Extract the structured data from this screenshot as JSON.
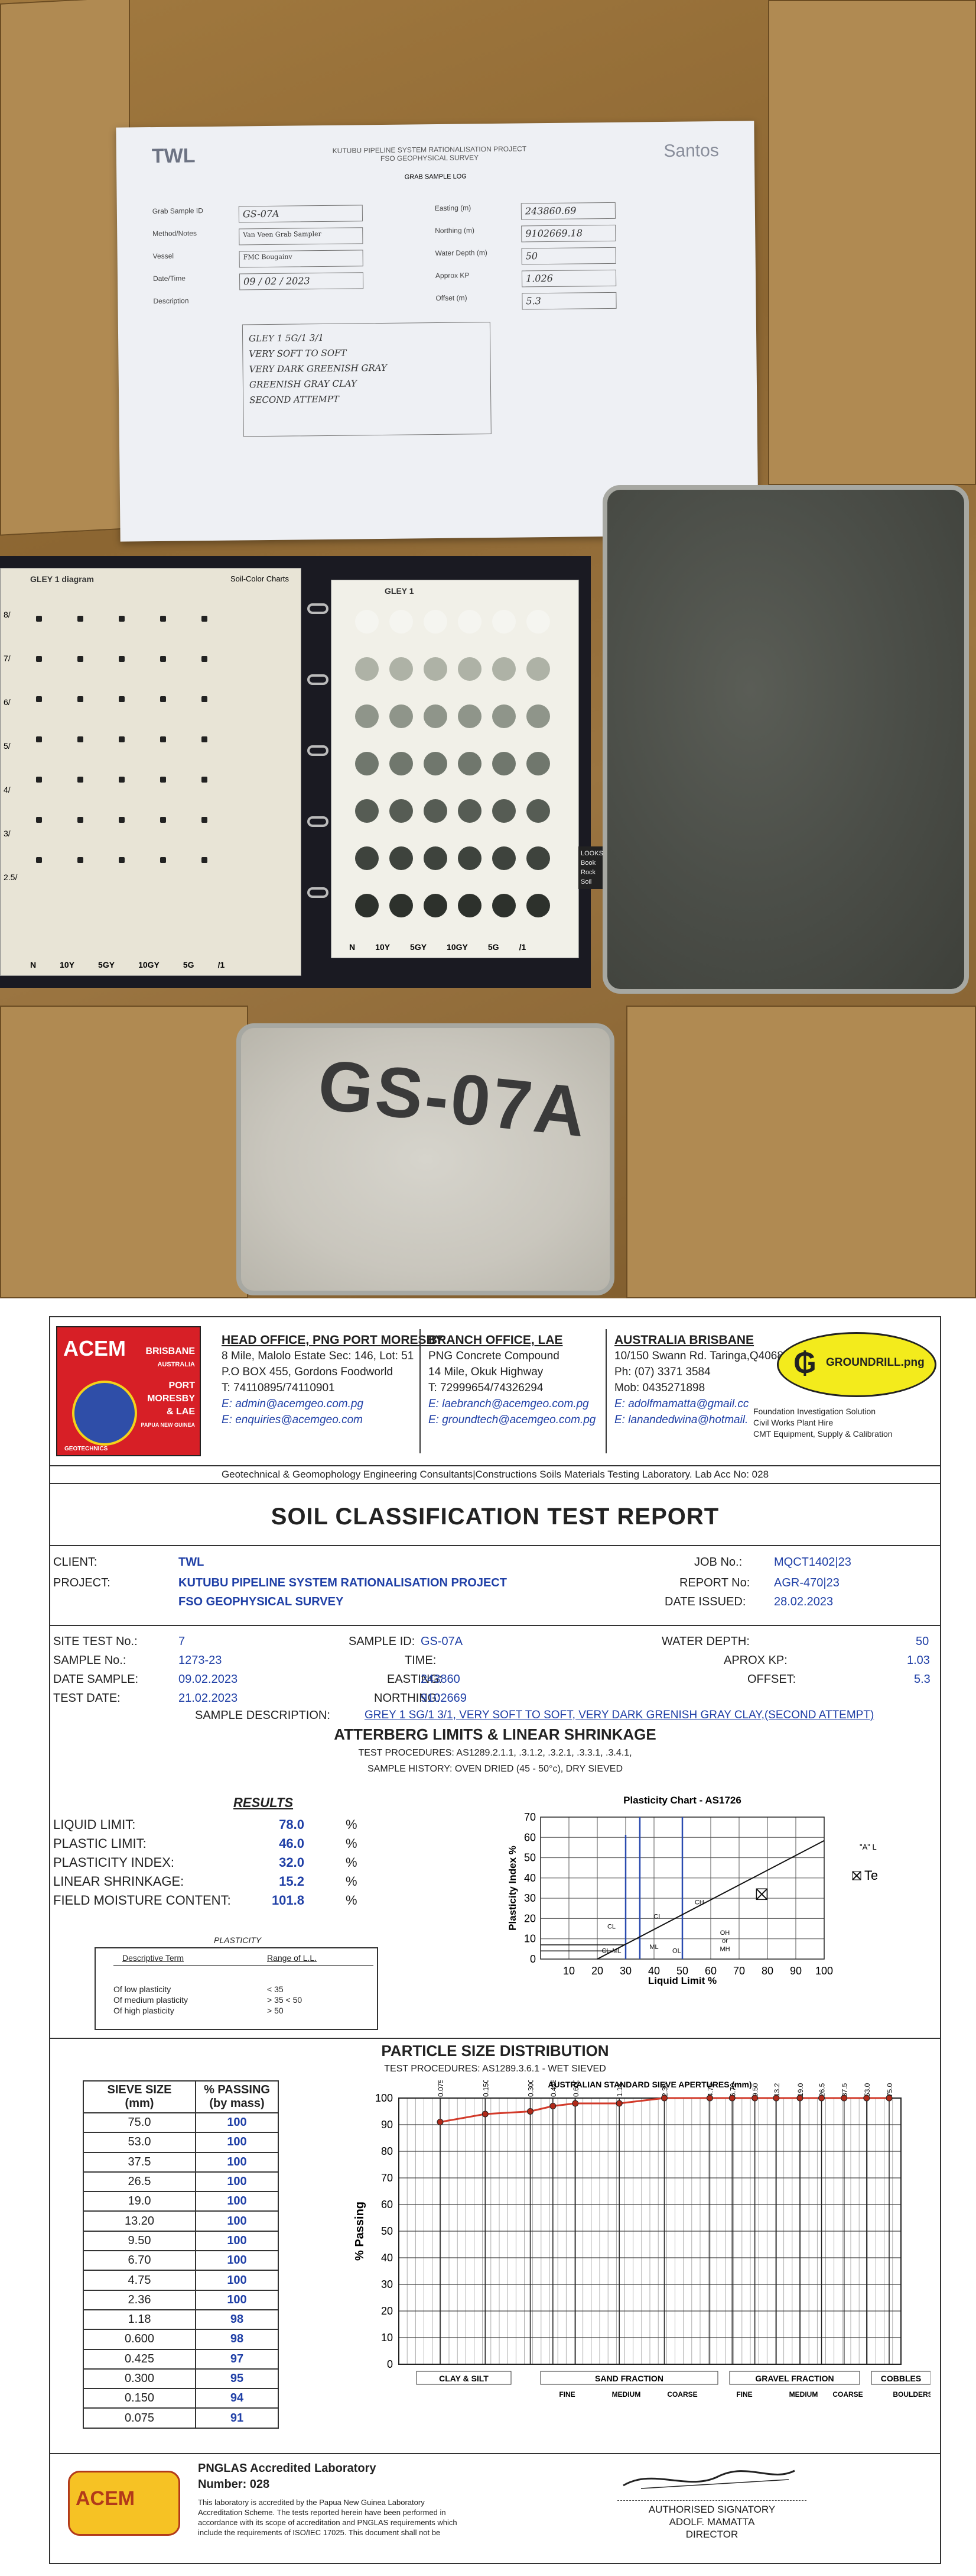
{
  "photo": {
    "sample_sheet": {
      "logo": "TWL",
      "project_line1": "KUTUBU PIPELINE SYSTEM RATIONALISATION PROJECT",
      "project_line2": "FSO GEOPHYSICAL SURVEY",
      "client_logo": "Santos",
      "form_title": "GRAB SAMPLE LOG",
      "labels": [
        "Grab Sample ID",
        "Method/Notes",
        "Vessel",
        "Date/Time",
        "Description",
        "Easting (m)",
        "Northing (m)",
        "Water Depth (m)",
        "Approx KP",
        "Offset (m)"
      ],
      "sample_id": "GS-07A",
      "method": "Van Veen Grab Sampler",
      "vessel": "FMC Bougainv",
      "date_time": "09 / 02 / 2023",
      "easting": "243860.69",
      "northing": "9102669.18",
      "water_depth": "50",
      "kp": "1.026",
      "offset": "5.3",
      "description_lines": [
        "GLEY 1 5G/1 3/1",
        "VERY SOFT TO SOFT",
        "VERY DARK GREENISH GRAY",
        "GREENISH GRAY CLAY",
        "SECOND ATTEMPT"
      ]
    },
    "munsell": {
      "left_title": "GLEY 1 diagram",
      "right_title": "GLEY 1",
      "chart_name": "Soil-Color Charts",
      "right_side_words": [
        "LOOKS",
        "Book",
        "Rock",
        "Soil"
      ],
      "left_bottom_labels": [
        "N",
        "10Y",
        "5GY",
        "10GY",
        "5G",
        "/1"
      ],
      "right_bottom_labels": [
        "N",
        "10Y",
        "5GY",
        "10GY",
        "5G",
        "/1"
      ],
      "value_labels": [
        "8/",
        "7/",
        "6/",
        "5/",
        "4/",
        "3/",
        "2.5/"
      ]
    },
    "tray_label": "GS-07A"
  },
  "report": {
    "offices": [
      {
        "title": "HEAD OFFICE, PNG PORT MORESBY",
        "lines": [
          "8 Mile, Malolo Estate Sec: 146, Lot: 51",
          "P.O BOX 455, Gordons Foodworld",
          "T: 74110895/74110901"
        ],
        "emails": [
          "E: admin@acemgeo.com.pg",
          "E: enquiries@acemgeo.com"
        ]
      },
      {
        "title": "BRANCH OFFICE, LAE",
        "lines": [
          "PNG Concrete Compound",
          "14 Mile, Okuk Highway",
          "T: 72999654/74326294"
        ],
        "emails": [
          "E: laebranch@acemgeo.com.pg",
          "E: groundtech@acemgeo.com.pg"
        ]
      },
      {
        "title": "AUSTRALIA BRISBANE",
        "lines": [
          "10/150 Swann Rd. Taringa,Q4068",
          "Ph: (07) 3371 3584",
          "Mob: 0435271898"
        ],
        "emails": [
          "E: adolfmamatta@gmail.cc",
          "E: lanandedwina@hotmail."
        ]
      }
    ],
    "acem_logo": {
      "name": "ACEM",
      "tag": "GEOTECHNICS",
      "locations": [
        "BRISBANE",
        "AUSTRALIA",
        "PORT",
        "MORESBY",
        "& LAE",
        "PAPUA NEW GUINEA"
      ]
    },
    "groundrill": {
      "name": "GROUNDRILL.png",
      "notes": [
        "Foundation Investigation Solution",
        "Civil Works Plant Hire",
        "CMT Equipment, Supply & Calibration"
      ]
    },
    "accreditation_line": "Geotechnical & Geomophology Engineering Consultants|Constructions Soils Materials Testing Laboratory. Lab Acc No: 028",
    "title": "SOIL CLASSIFICATION TEST REPORT",
    "client_label": "CLIENT:",
    "client": "TWL",
    "project_label": "PROJECT:",
    "project_1": "KUTUBU PIPELINE SYSTEM RATIONALISATION PROJECT",
    "project_2": "FSO GEOPHYSICAL SURVEY",
    "job_no_label": "JOB No.:",
    "job_no": "MQCT1402|23",
    "report_no_label": "REPORT No:",
    "report_no": "AGR-470|23",
    "date_issued_label": "DATE ISSUED:",
    "date_issued": "28.02.2023",
    "site_test_label": "SITE TEST No.:",
    "site_test": "7",
    "sample_id_label": "SAMPLE ID:",
    "sample_id": "GS-07A",
    "water_depth_label": "WATER DEPTH:",
    "water_depth": "50",
    "sample_no_label": "SAMPLE No.:",
    "sample_no": "1273-23",
    "time_label": "TIME:",
    "kp_label": "APROX KP:",
    "kp": "1.03",
    "date_sample_label": "DATE SAMPLE:",
    "date_sample": "09.02.2023",
    "easting_label": "EASTING:",
    "easting": "243860",
    "offset_label": "OFFSET:",
    "offset": "5.3",
    "test_date_label": "TEST DATE:",
    "test_date": "21.02.2023",
    "northing_label": "NORTHING:",
    "northing": "9102669",
    "sample_desc_label": "SAMPLE DESCRIPTION:",
    "sample_desc": "GREY 1 SG/1 3/1, VERY SOFT TO SOFT, VERY DARK GRENISH GRAY CLAY,(SECOND ATTEMPT)",
    "atterberg": {
      "title": "ATTERBERG LIMITS & LINEAR SHRINKAGE",
      "procedures": "TEST PROCEDURES: AS1289.2.1.1, .3.1.2, .3.2.1, .3.3.1, .3.4.1,",
      "history": "SAMPLE HISTORY: OVEN DRIED (45 - 50°c), DRY SIEVED",
      "results_title": "RESULTS",
      "rows": [
        {
          "label": "LIQUID LIMIT:",
          "value": "78.0",
          "unit": "%"
        },
        {
          "label": "PLASTIC LIMIT:",
          "value": "46.0",
          "unit": "%"
        },
        {
          "label": "PLASTICITY INDEX:",
          "value": "32.0",
          "unit": "%"
        },
        {
          "label": "LINEAR SHRINKAGE:",
          "value": "15.2",
          "unit": "%"
        },
        {
          "label": "FIELD MOISTURE CONTENT:",
          "value": "101.8",
          "unit": "%"
        }
      ],
      "plasticity_box": {
        "title": "PLASTICITY",
        "col1": "Descriptive Term",
        "col2": "Range of L.L.",
        "terms": [
          "Of low plasticity",
          "Of medium plasticity",
          "Of high plasticity"
        ],
        "ranges": [
          "< 35",
          "> 35  < 50",
          "> 50"
        ]
      }
    },
    "chart_data": [
      {
        "type": "scatter",
        "title": "Plasticity Chart - AS1726",
        "xlabel": "Liquid Limit %",
        "ylabel": "Plasticity Index %",
        "xlim": [
          0,
          100
        ],
        "ylim": [
          0,
          70
        ],
        "xticks": [
          10,
          20,
          30,
          40,
          50,
          60,
          70,
          80,
          90,
          100
        ],
        "yticks": [
          0,
          10,
          20,
          30,
          40,
          50,
          60,
          70
        ],
        "a_line_label": "\"A\" LINE",
        "zone_labels": [
          "CL",
          "CI",
          "CH",
          "ML",
          "OH",
          "or",
          "MH",
          "CL-ML",
          "OL"
        ],
        "legend": "Test Plot",
        "points": [
          {
            "x": 78.0,
            "y": 32.0
          }
        ],
        "a_line": [
          {
            "x": 20,
            "y": 0
          },
          {
            "x": 100,
            "y": 58.4
          }
        ]
      },
      {
        "type": "line",
        "title": "PARTICLE SIZE DISTRIBUTION",
        "procedures": "TEST PROCEDURES: AS1289.3.6.1 - WET SIEVED",
        "top_axis_title": "AUSTRALIAN STANDARD SIEVE APERTURES (mm)",
        "top_ticks": [
          "0.075",
          "0.150",
          "0.300",
          "0.425",
          "0.600",
          "1.18",
          "2.36",
          "4.75",
          "6.70",
          "9.50",
          "13.2",
          "19.0",
          "26.5",
          "37.5",
          "53.0",
          "75.0"
        ],
        "ylabel": "% Passing",
        "ylim": [
          0,
          100
        ],
        "yticks": [
          0,
          10,
          20,
          30,
          40,
          50,
          60,
          70,
          80,
          90,
          100
        ],
        "bottom_groups": [
          "CLAY & SILT",
          "SAND FRACTION",
          "GRAVEL FRACTION",
          "COBBLES"
        ],
        "bottom_sub": [
          "FINE",
          "MEDIUM",
          "COARSE",
          "FINE",
          "MEDIUM",
          "COARSE",
          "BOULDERS"
        ],
        "series": [
          {
            "values": [
              91,
              94,
              95,
              97,
              98,
              98,
              100,
              100,
              100,
              100,
              100,
              100,
              100,
              100,
              100,
              100
            ]
          }
        ]
      }
    ],
    "psd_table": {
      "col1": [
        "SIEVE SIZE",
        "(mm)"
      ],
      "col2": [
        "% PASSING",
        "(by mass)"
      ],
      "rows": [
        [
          "75.0",
          "100"
        ],
        [
          "53.0",
          "100"
        ],
        [
          "37.5",
          "100"
        ],
        [
          "26.5",
          "100"
        ],
        [
          "19.0",
          "100"
        ],
        [
          "13.20",
          "100"
        ],
        [
          "9.50",
          "100"
        ],
        [
          "6.70",
          "100"
        ],
        [
          "4.75",
          "100"
        ],
        [
          "2.36",
          "100"
        ],
        [
          "1.18",
          "98"
        ],
        [
          "0.600",
          "98"
        ],
        [
          "0.425",
          "97"
        ],
        [
          "0.300",
          "95"
        ],
        [
          "0.150",
          "94"
        ],
        [
          "0.075",
          "91"
        ]
      ]
    },
    "footer": {
      "logo": "ACEM",
      "lab_title": "PNGLAS Accredited Laboratory",
      "lab_number": "Number:  028",
      "notes": [
        "This laboratory is accredited by the Papua New Guinea Laboratory",
        "Accreditation Scheme. The tests reported herein have been performed in",
        "accordance with its scope of accreditation and PNGLAS requirements which",
        "include the requirements of ISO/IEC 17025. This document shall not be"
      ],
      "sign_1": "AUTHORISED SIGNATORY",
      "sign_2": "ADOLF. MAMATTA",
      "sign_3": "DIRECTOR"
    }
  }
}
